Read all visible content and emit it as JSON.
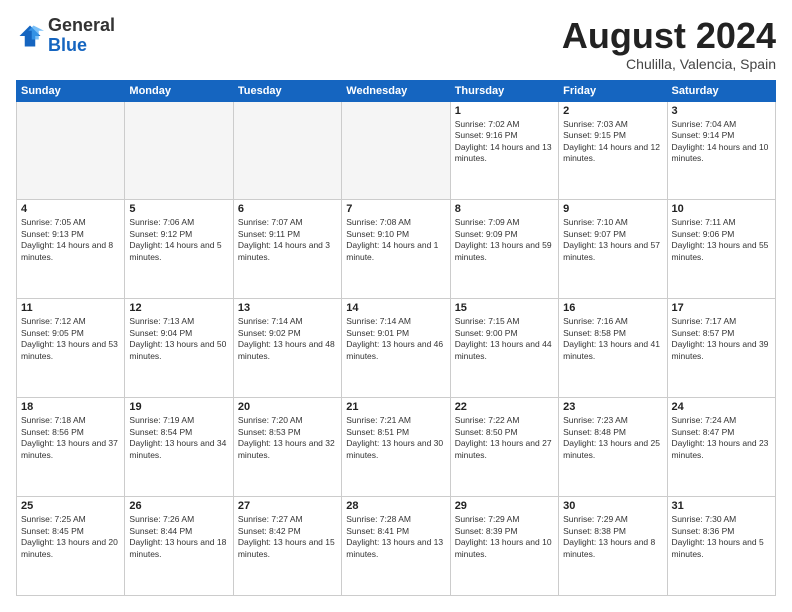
{
  "header": {
    "logo": {
      "general": "General",
      "blue": "Blue"
    },
    "title": "August 2024",
    "location": "Chulilla, Valencia, Spain"
  },
  "weekdays": [
    "Sunday",
    "Monday",
    "Tuesday",
    "Wednesday",
    "Thursday",
    "Friday",
    "Saturday"
  ],
  "weeks": [
    [
      {
        "day": "",
        "empty": true
      },
      {
        "day": "",
        "empty": true
      },
      {
        "day": "",
        "empty": true
      },
      {
        "day": "",
        "empty": true
      },
      {
        "day": "1",
        "sunrise": "7:02 AM",
        "sunset": "9:16 PM",
        "daylight": "14 hours and 13 minutes."
      },
      {
        "day": "2",
        "sunrise": "7:03 AM",
        "sunset": "9:15 PM",
        "daylight": "14 hours and 12 minutes."
      },
      {
        "day": "3",
        "sunrise": "7:04 AM",
        "sunset": "9:14 PM",
        "daylight": "14 hours and 10 minutes."
      }
    ],
    [
      {
        "day": "4",
        "sunrise": "7:05 AM",
        "sunset": "9:13 PM",
        "daylight": "14 hours and 8 minutes."
      },
      {
        "day": "5",
        "sunrise": "7:06 AM",
        "sunset": "9:12 PM",
        "daylight": "14 hours and 5 minutes."
      },
      {
        "day": "6",
        "sunrise": "7:07 AM",
        "sunset": "9:11 PM",
        "daylight": "14 hours and 3 minutes."
      },
      {
        "day": "7",
        "sunrise": "7:08 AM",
        "sunset": "9:10 PM",
        "daylight": "14 hours and 1 minute."
      },
      {
        "day": "8",
        "sunrise": "7:09 AM",
        "sunset": "9:09 PM",
        "daylight": "13 hours and 59 minutes."
      },
      {
        "day": "9",
        "sunrise": "7:10 AM",
        "sunset": "9:07 PM",
        "daylight": "13 hours and 57 minutes."
      },
      {
        "day": "10",
        "sunrise": "7:11 AM",
        "sunset": "9:06 PM",
        "daylight": "13 hours and 55 minutes."
      }
    ],
    [
      {
        "day": "11",
        "sunrise": "7:12 AM",
        "sunset": "9:05 PM",
        "daylight": "13 hours and 53 minutes."
      },
      {
        "day": "12",
        "sunrise": "7:13 AM",
        "sunset": "9:04 PM",
        "daylight": "13 hours and 50 minutes."
      },
      {
        "day": "13",
        "sunrise": "7:14 AM",
        "sunset": "9:02 PM",
        "daylight": "13 hours and 48 minutes."
      },
      {
        "day": "14",
        "sunrise": "7:14 AM",
        "sunset": "9:01 PM",
        "daylight": "13 hours and 46 minutes."
      },
      {
        "day": "15",
        "sunrise": "7:15 AM",
        "sunset": "9:00 PM",
        "daylight": "13 hours and 44 minutes."
      },
      {
        "day": "16",
        "sunrise": "7:16 AM",
        "sunset": "8:58 PM",
        "daylight": "13 hours and 41 minutes."
      },
      {
        "day": "17",
        "sunrise": "7:17 AM",
        "sunset": "8:57 PM",
        "daylight": "13 hours and 39 minutes."
      }
    ],
    [
      {
        "day": "18",
        "sunrise": "7:18 AM",
        "sunset": "8:56 PM",
        "daylight": "13 hours and 37 minutes."
      },
      {
        "day": "19",
        "sunrise": "7:19 AM",
        "sunset": "8:54 PM",
        "daylight": "13 hours and 34 minutes."
      },
      {
        "day": "20",
        "sunrise": "7:20 AM",
        "sunset": "8:53 PM",
        "daylight": "13 hours and 32 minutes."
      },
      {
        "day": "21",
        "sunrise": "7:21 AM",
        "sunset": "8:51 PM",
        "daylight": "13 hours and 30 minutes."
      },
      {
        "day": "22",
        "sunrise": "7:22 AM",
        "sunset": "8:50 PM",
        "daylight": "13 hours and 27 minutes."
      },
      {
        "day": "23",
        "sunrise": "7:23 AM",
        "sunset": "8:48 PM",
        "daylight": "13 hours and 25 minutes."
      },
      {
        "day": "24",
        "sunrise": "7:24 AM",
        "sunset": "8:47 PM",
        "daylight": "13 hours and 23 minutes."
      }
    ],
    [
      {
        "day": "25",
        "sunrise": "7:25 AM",
        "sunset": "8:45 PM",
        "daylight": "13 hours and 20 minutes."
      },
      {
        "day": "26",
        "sunrise": "7:26 AM",
        "sunset": "8:44 PM",
        "daylight": "13 hours and 18 minutes."
      },
      {
        "day": "27",
        "sunrise": "7:27 AM",
        "sunset": "8:42 PM",
        "daylight": "13 hours and 15 minutes."
      },
      {
        "day": "28",
        "sunrise": "7:28 AM",
        "sunset": "8:41 PM",
        "daylight": "13 hours and 13 minutes."
      },
      {
        "day": "29",
        "sunrise": "7:29 AM",
        "sunset": "8:39 PM",
        "daylight": "13 hours and 10 minutes."
      },
      {
        "day": "30",
        "sunrise": "7:29 AM",
        "sunset": "8:38 PM",
        "daylight": "13 hours and 8 minutes."
      },
      {
        "day": "31",
        "sunrise": "7:30 AM",
        "sunset": "8:36 PM",
        "daylight": "13 hours and 5 minutes."
      }
    ]
  ]
}
